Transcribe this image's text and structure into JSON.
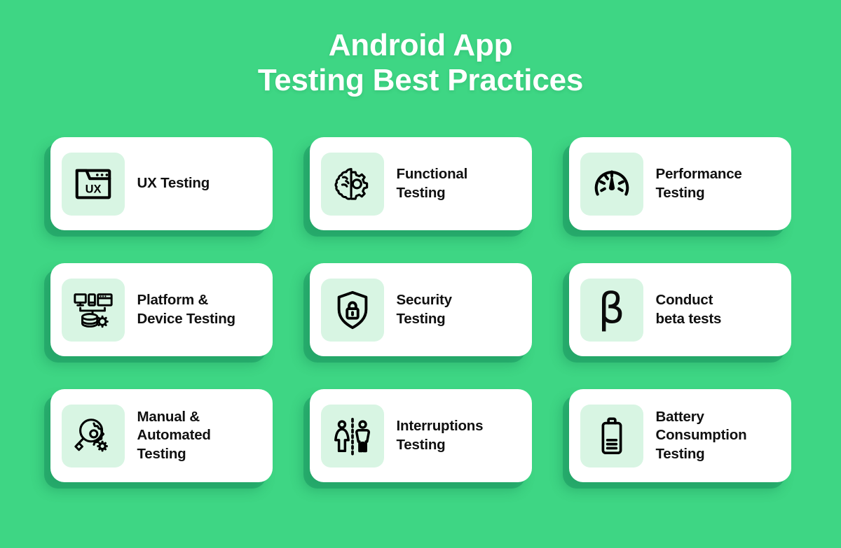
{
  "header": {
    "title_line1": "Android App",
    "title_line2": "Testing Best Practices"
  },
  "theme": {
    "background_green": "#3ed684",
    "card_white": "#ffffff",
    "icon_tile_mint": "#d8f5e3",
    "shadow_green": "#199660",
    "text_dark": "#101010",
    "title_white": "#ffffff"
  },
  "cards": [
    {
      "label": "UX Testing",
      "icon": "ux-browser-window-icon"
    },
    {
      "label": "Functional\nTesting",
      "icon": "brain-gear-icon"
    },
    {
      "label": "Performance\nTesting",
      "icon": "speedometer-gauge-icon"
    },
    {
      "label": "Platform &\nDevice Testing",
      "icon": "devices-database-gear-icon"
    },
    {
      "label": "Security\nTesting",
      "icon": "shield-lock-icon"
    },
    {
      "label": "Conduct\nbeta tests",
      "icon": "beta-symbol-icon",
      "glyph": "β"
    },
    {
      "label": "Manual &\nAutomated\nTesting",
      "icon": "magnifier-gear-icon"
    },
    {
      "label": "Interruptions\nTesting",
      "icon": "two-people-divider-icon"
    },
    {
      "label": "Battery\nConsumption\nTesting",
      "icon": "battery-level-icon"
    }
  ]
}
